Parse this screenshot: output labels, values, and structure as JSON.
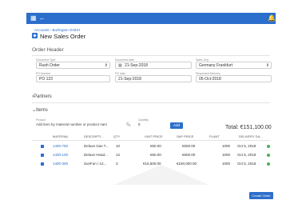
{
  "topbar": {
    "menu_icon": "grid-icon",
    "back_icon": "arrow-left-icon",
    "bell_icon": "bell-icon",
    "color": "#2c6ecb"
  },
  "header": {
    "breadcrumb": "Accounts › Burlington GmbH",
    "title": "New Sales Order"
  },
  "order_header": {
    "section_title": "Order Header",
    "document_type": {
      "label": "Document Type",
      "value": "Rush Order"
    },
    "document_date": {
      "label": "Document date",
      "value": "21-Sep-2018"
    },
    "sales_org": {
      "label": "Sales Org.",
      "value": "Germany Frankfurt"
    },
    "po_number": {
      "label": "PO Number",
      "value": "PO 123"
    },
    "po_date": {
      "label": "PO date",
      "value": "21-Sep-2018"
    },
    "requested_delivery": {
      "label": "Requested Delivery",
      "value": "05-Oct-2018"
    }
  },
  "partners": {
    "title": "Partners"
  },
  "items": {
    "title": "Items",
    "product_label": "Product",
    "product_placeholder": "Add item by material number or product nam",
    "quantity_label": "Quantity",
    "quantity_value": "5",
    "add_label": "Add",
    "total": "Total: €151,100.00",
    "columns": [
      "MATERIAL",
      "DESCRIPTI...",
      "QTY",
      "UNIT PRICE",
      "SAP PRICE",
      "PLANT",
      "DELIVERY DA..."
    ],
    "rows": [
      {
        "material": "1400-750",
        "description": "Deluxe Gas T...",
        "qty": "10",
        "unit_price": "€50.00",
        "sap_price": "€500.00",
        "plant": "1000",
        "delivery": "Oct 5, 2018"
      },
      {
        "material": "1400-100",
        "description": "Deluxe Head...",
        "qty": "12",
        "unit_price": "€60.00",
        "sap_price": "€600.00",
        "plant": "1000",
        "delivery": "Oct 5, 2018"
      },
      {
        "material": "1400-300",
        "description": "SunFun / 12...",
        "qty": "3",
        "unit_price": "€15,500.00",
        "sap_price": "€150,000.00",
        "plant": "1000",
        "delivery": "Oct 5, 2018"
      }
    ]
  },
  "footer": {
    "create_label": "Create Order"
  }
}
